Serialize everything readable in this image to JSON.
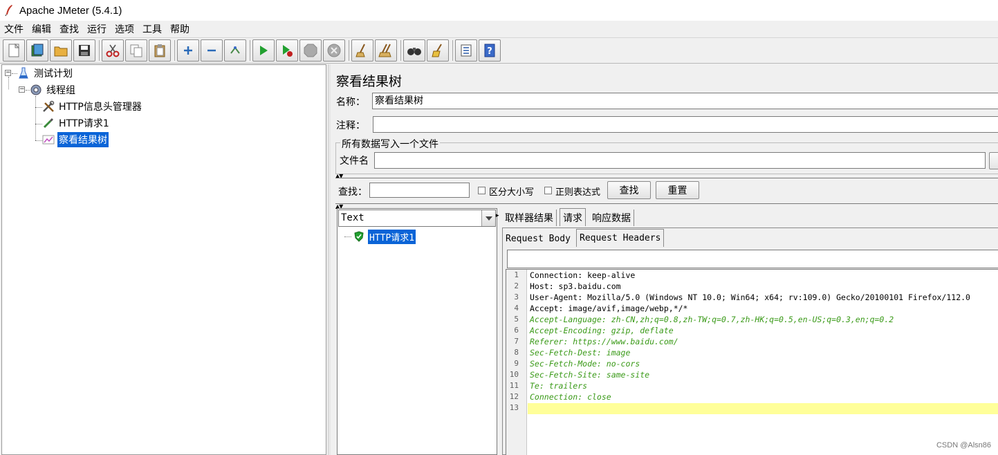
{
  "window": {
    "title": "Apache JMeter (5.4.1)"
  },
  "menu": [
    "文件",
    "编辑",
    "查找",
    "运行",
    "选项",
    "工具",
    "帮助"
  ],
  "tree": {
    "test_plan": "测试计划",
    "thread_group": "线程组",
    "header_manager": "HTTP信息头管理器",
    "http_request": "HTTP请求1",
    "view_results_tree": "察看结果树"
  },
  "panel": {
    "title": "察看结果树",
    "name_label": "名称：",
    "name_value": "察看结果树",
    "comment_label": "注释：",
    "comment_value": "",
    "file_group_legend": "所有数据写入一个文件",
    "filename_label": "文件名",
    "filename_value": ""
  },
  "search": {
    "label": "查找：",
    "value": "",
    "case_sensitive": "区分大小写",
    "regex": "正则表达式",
    "find_button": "查找",
    "reset_button": "重置"
  },
  "results": {
    "renderer": "Text",
    "items": [
      "HTTP请求1"
    ]
  },
  "tabs": [
    "取样器结果",
    "请求",
    "响应数据"
  ],
  "subtabs": [
    "Request Body",
    "Request Headers"
  ],
  "code_lines": [
    {
      "n": "1",
      "text": "Connection: keep-alive"
    },
    {
      "n": "2",
      "text": "Host: sp3.baidu.com"
    },
    {
      "n": "3",
      "text": "User-Agent: Mozilla/5.0 (Windows NT 10.0; Win64; x64; rv:109.0) Gecko/20100101 Firefox/112.0"
    },
    {
      "n": "4",
      "text": "Accept: image/avif,image/webp,*/*"
    },
    {
      "n": "5",
      "text": "Accept-Language: zh-CN,zh;q=0.8,zh-TW;q=0.7,zh-HK;q=0.5,en-US;q=0.3,en;q=0.2"
    },
    {
      "n": "6",
      "text": "Accept-Encoding: gzip, deflate"
    },
    {
      "n": "7",
      "text": "Referer: https://www.baidu.com/"
    },
    {
      "n": "8",
      "text": "Sec-Fetch-Dest: image"
    },
    {
      "n": "9",
      "text": "Sec-Fetch-Mode: no-cors"
    },
    {
      "n": "10",
      "text": "Sec-Fetch-Site: same-site"
    },
    {
      "n": "11",
      "text": "Te: trailers"
    },
    {
      "n": "12",
      "text": "Connection: close"
    },
    {
      "n": "13",
      "text": ""
    }
  ],
  "watermark": "CSDN @Alsn86",
  "colors": {
    "selection": "#0a64d7",
    "comment_green": "#3a9a18",
    "highlight_line": "#ffff99"
  }
}
